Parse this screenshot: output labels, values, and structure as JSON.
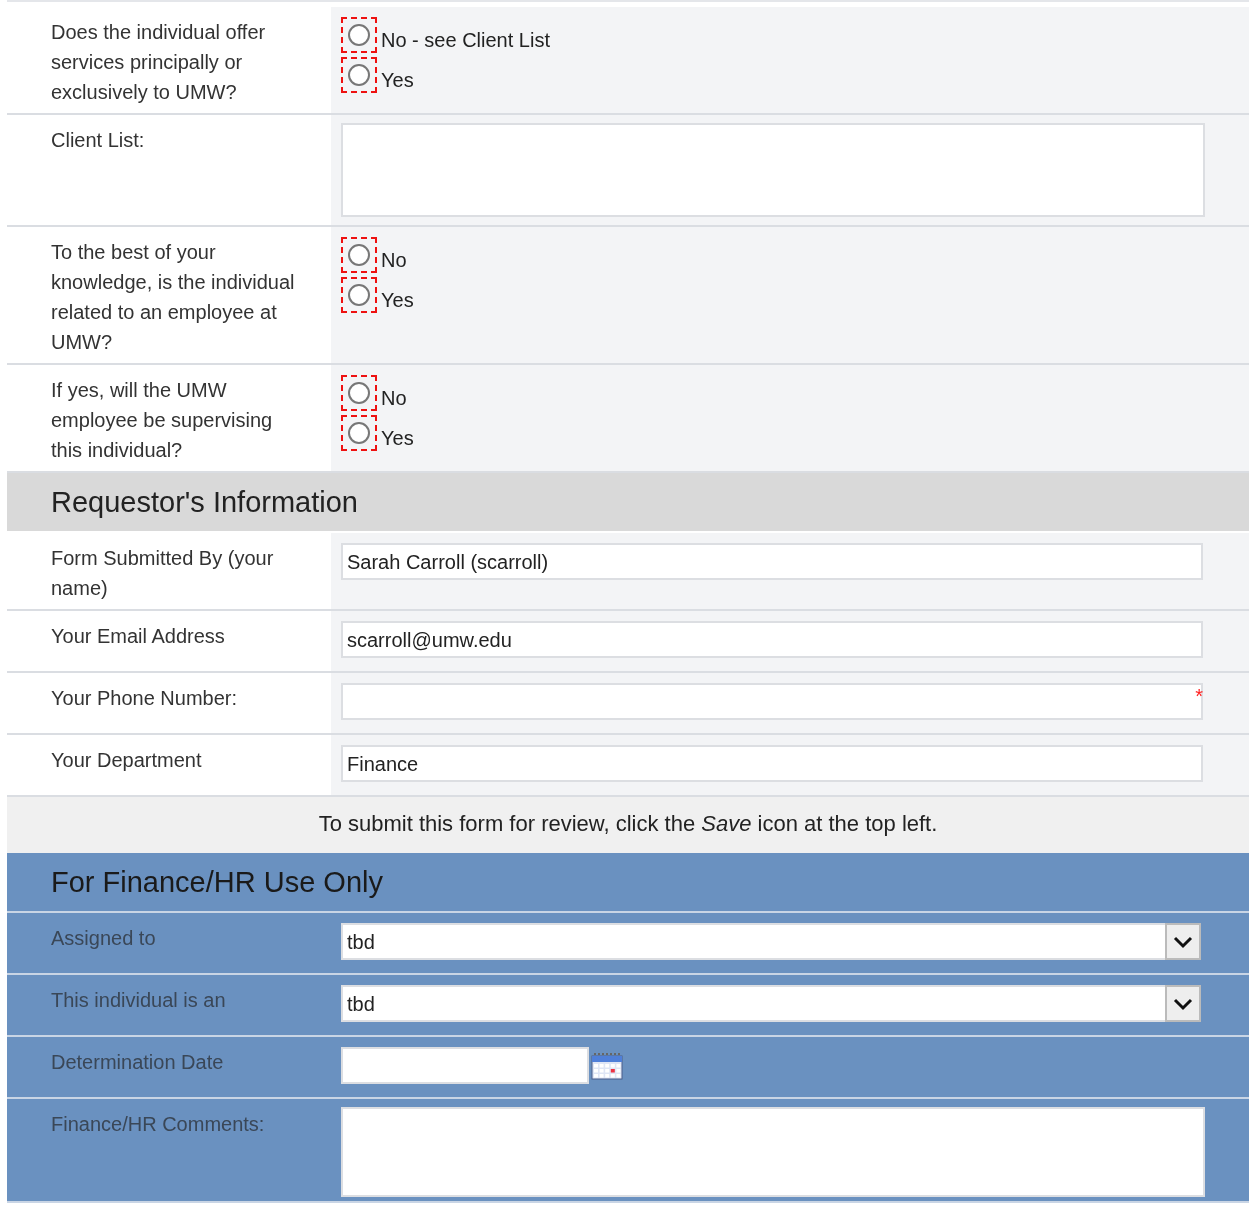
{
  "sections": [
    {
      "kind": "fields",
      "shaded": false,
      "rows": [
        {
          "kind": "radio",
          "label": "Does the individual offer services principally or exclusively to UMW?",
          "invalid": true,
          "options": [
            {
              "label": "No - see Client List",
              "selected": false
            },
            {
              "label": "Yes",
              "selected": false
            }
          ]
        },
        {
          "kind": "textarea",
          "label": "Client List:",
          "value": ""
        },
        {
          "kind": "radio",
          "label": "To the best of your knowledge, is the individual related to an employee at UMW?",
          "invalid": true,
          "options": [
            {
              "label": "No",
              "selected": false
            },
            {
              "label": "Yes",
              "selected": false
            }
          ]
        },
        {
          "kind": "radio",
          "label": "If yes, will the UMW employee be supervising this individual?",
          "invalid": true,
          "options": [
            {
              "label": "No",
              "selected": false
            },
            {
              "label": "Yes",
              "selected": false
            }
          ]
        }
      ]
    },
    {
      "kind": "header",
      "shaded": false,
      "title": "Requestor's Information"
    },
    {
      "kind": "fields",
      "shaded": false,
      "rows": [
        {
          "kind": "text",
          "label": "Form Submitted By (your name)",
          "value": "Sarah Carroll (scarroll)"
        },
        {
          "kind": "text",
          "label": "Your Email Address",
          "value": "scarroll@umw.edu"
        },
        {
          "kind": "text",
          "label": "Your Phone Number:",
          "value": "",
          "required_mark": "*"
        },
        {
          "kind": "text",
          "label": "Your Department",
          "value": "Finance"
        }
      ]
    },
    {
      "kind": "note",
      "text": "To submit this form for review, click the *Save* icon at the top left."
    },
    {
      "kind": "header",
      "shaded": true,
      "title": "For Finance/HR Use Only"
    },
    {
      "kind": "fields",
      "shaded": true,
      "rows": [
        {
          "kind": "select",
          "label": "Assigned to",
          "value": "tbd"
        },
        {
          "kind": "select",
          "label": "This individual is an",
          "value": "tbd"
        },
        {
          "kind": "date",
          "label": "Determination Date",
          "value": ""
        },
        {
          "kind": "textarea",
          "label": "Finance/HR Comments:",
          "value": ""
        }
      ]
    }
  ]
}
